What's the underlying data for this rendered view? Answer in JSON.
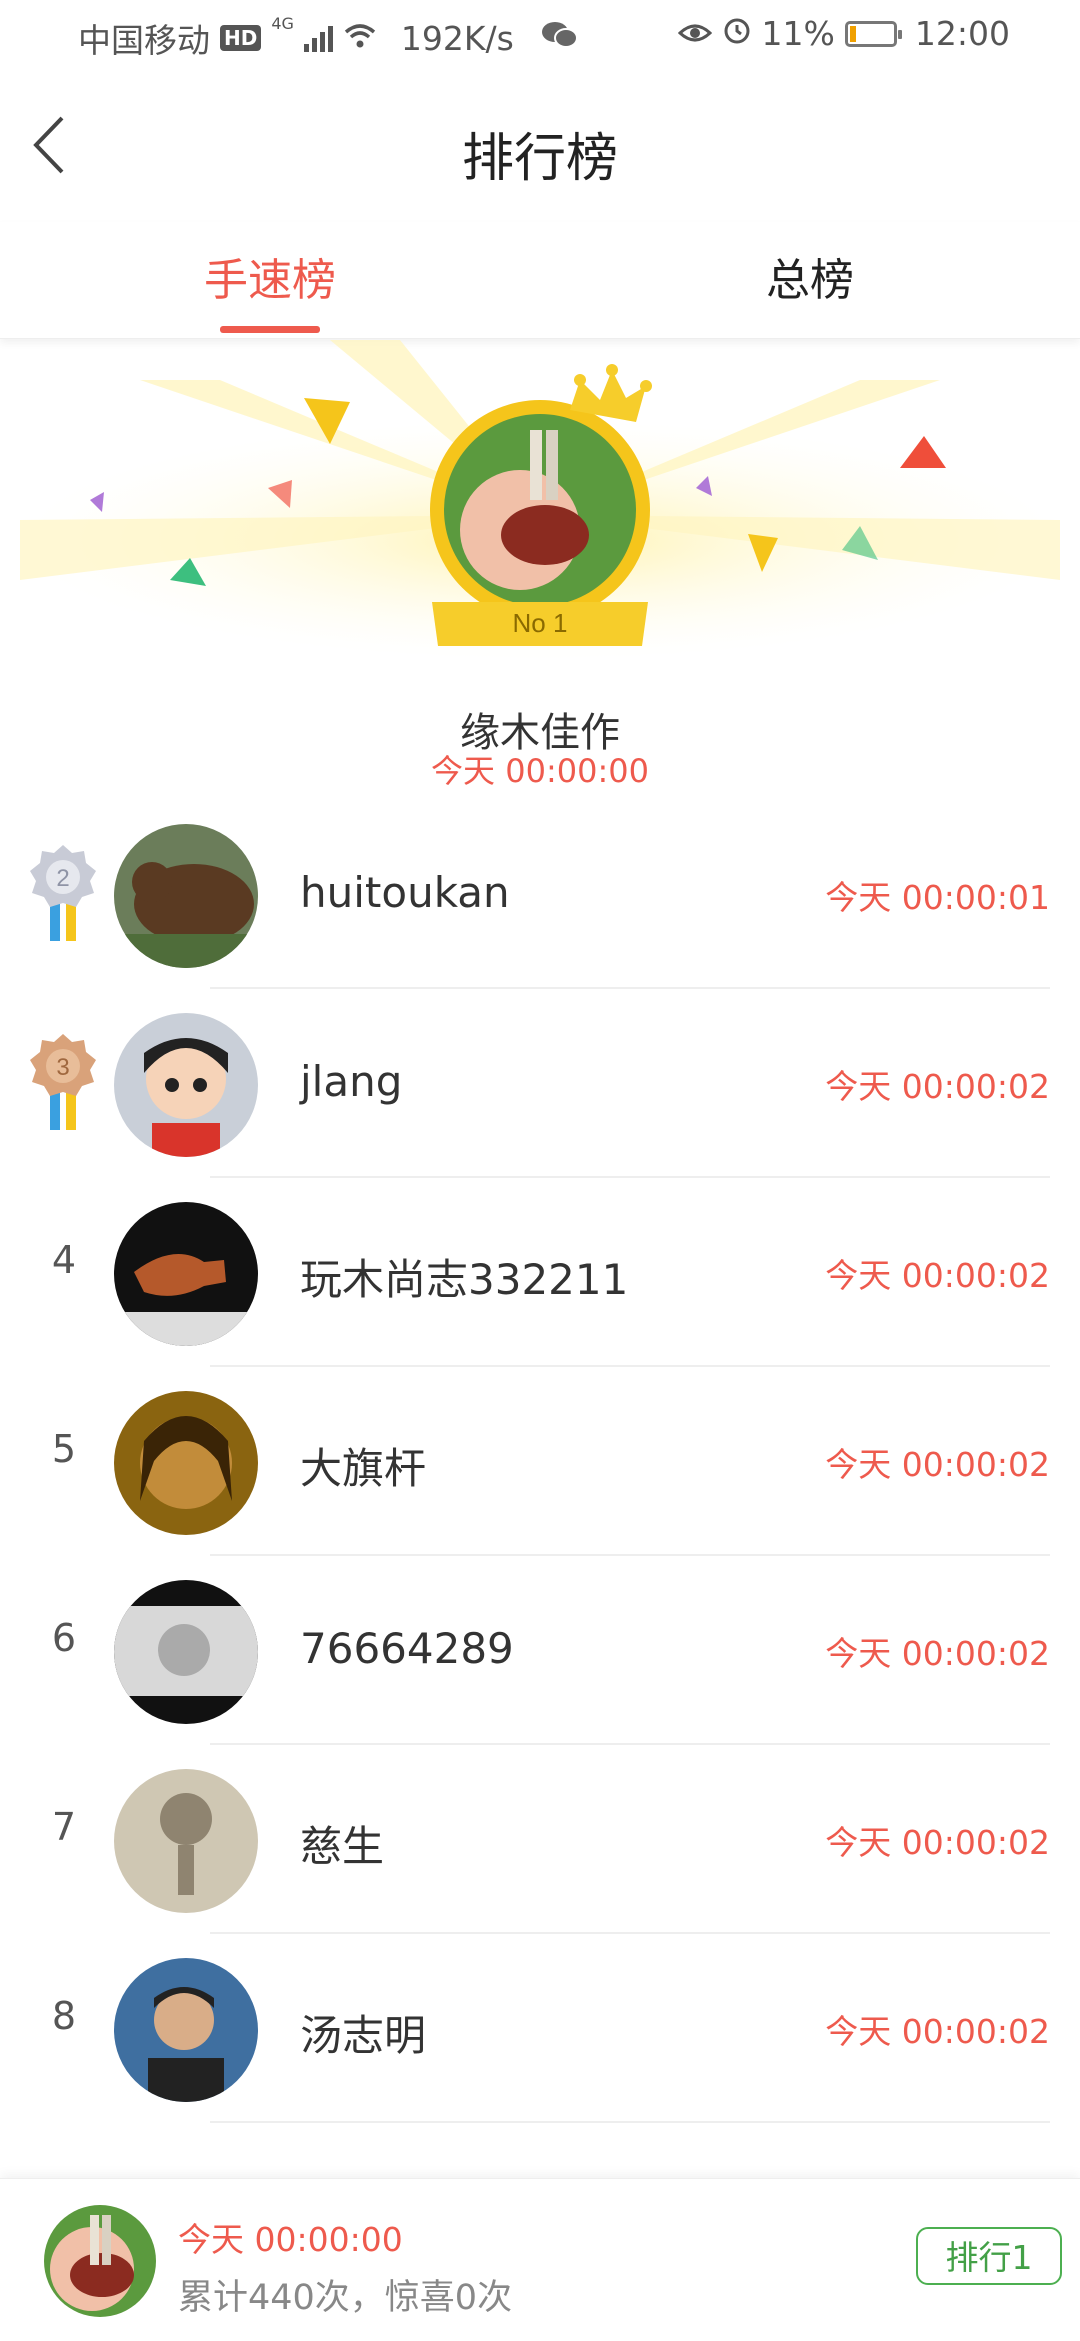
{
  "status_bar": {
    "carrier": "中国移动",
    "hd": "HD",
    "network": "4G",
    "speed": "192K/s",
    "battery": "11%",
    "time": "12:00"
  },
  "header": {
    "title": "排行榜"
  },
  "tabs": [
    {
      "label": "手速榜",
      "active": true
    },
    {
      "label": "总榜",
      "active": false
    }
  ],
  "top1": {
    "badge": "No 1",
    "name": "缘木佳作",
    "time": "今天 00:00:00"
  },
  "rankings": [
    {
      "rank": "2",
      "name": "huitoukan",
      "time": "今天 00:00:01",
      "medal": "silver"
    },
    {
      "rank": "3",
      "name": "jlang",
      "time": "今天 00:00:02",
      "medal": "bronze"
    },
    {
      "rank": "4",
      "name": "玩木尚志332211",
      "time": "今天 00:00:02"
    },
    {
      "rank": "5",
      "name": "大旗杆",
      "time": "今天 00:00:02"
    },
    {
      "rank": "6",
      "name": "76664289",
      "time": "今天 00:00:02"
    },
    {
      "rank": "7",
      "name": "慈生",
      "time": "今天 00:00:02"
    },
    {
      "rank": "8",
      "name": "汤志明",
      "time": "今天 00:00:02"
    }
  ],
  "footer": {
    "time": "今天 00:00:00",
    "stats": "累计440次，惊喜0次",
    "rank_button": "排行1"
  },
  "colors": {
    "accent": "#ee5a4d",
    "green": "#4caf50"
  }
}
